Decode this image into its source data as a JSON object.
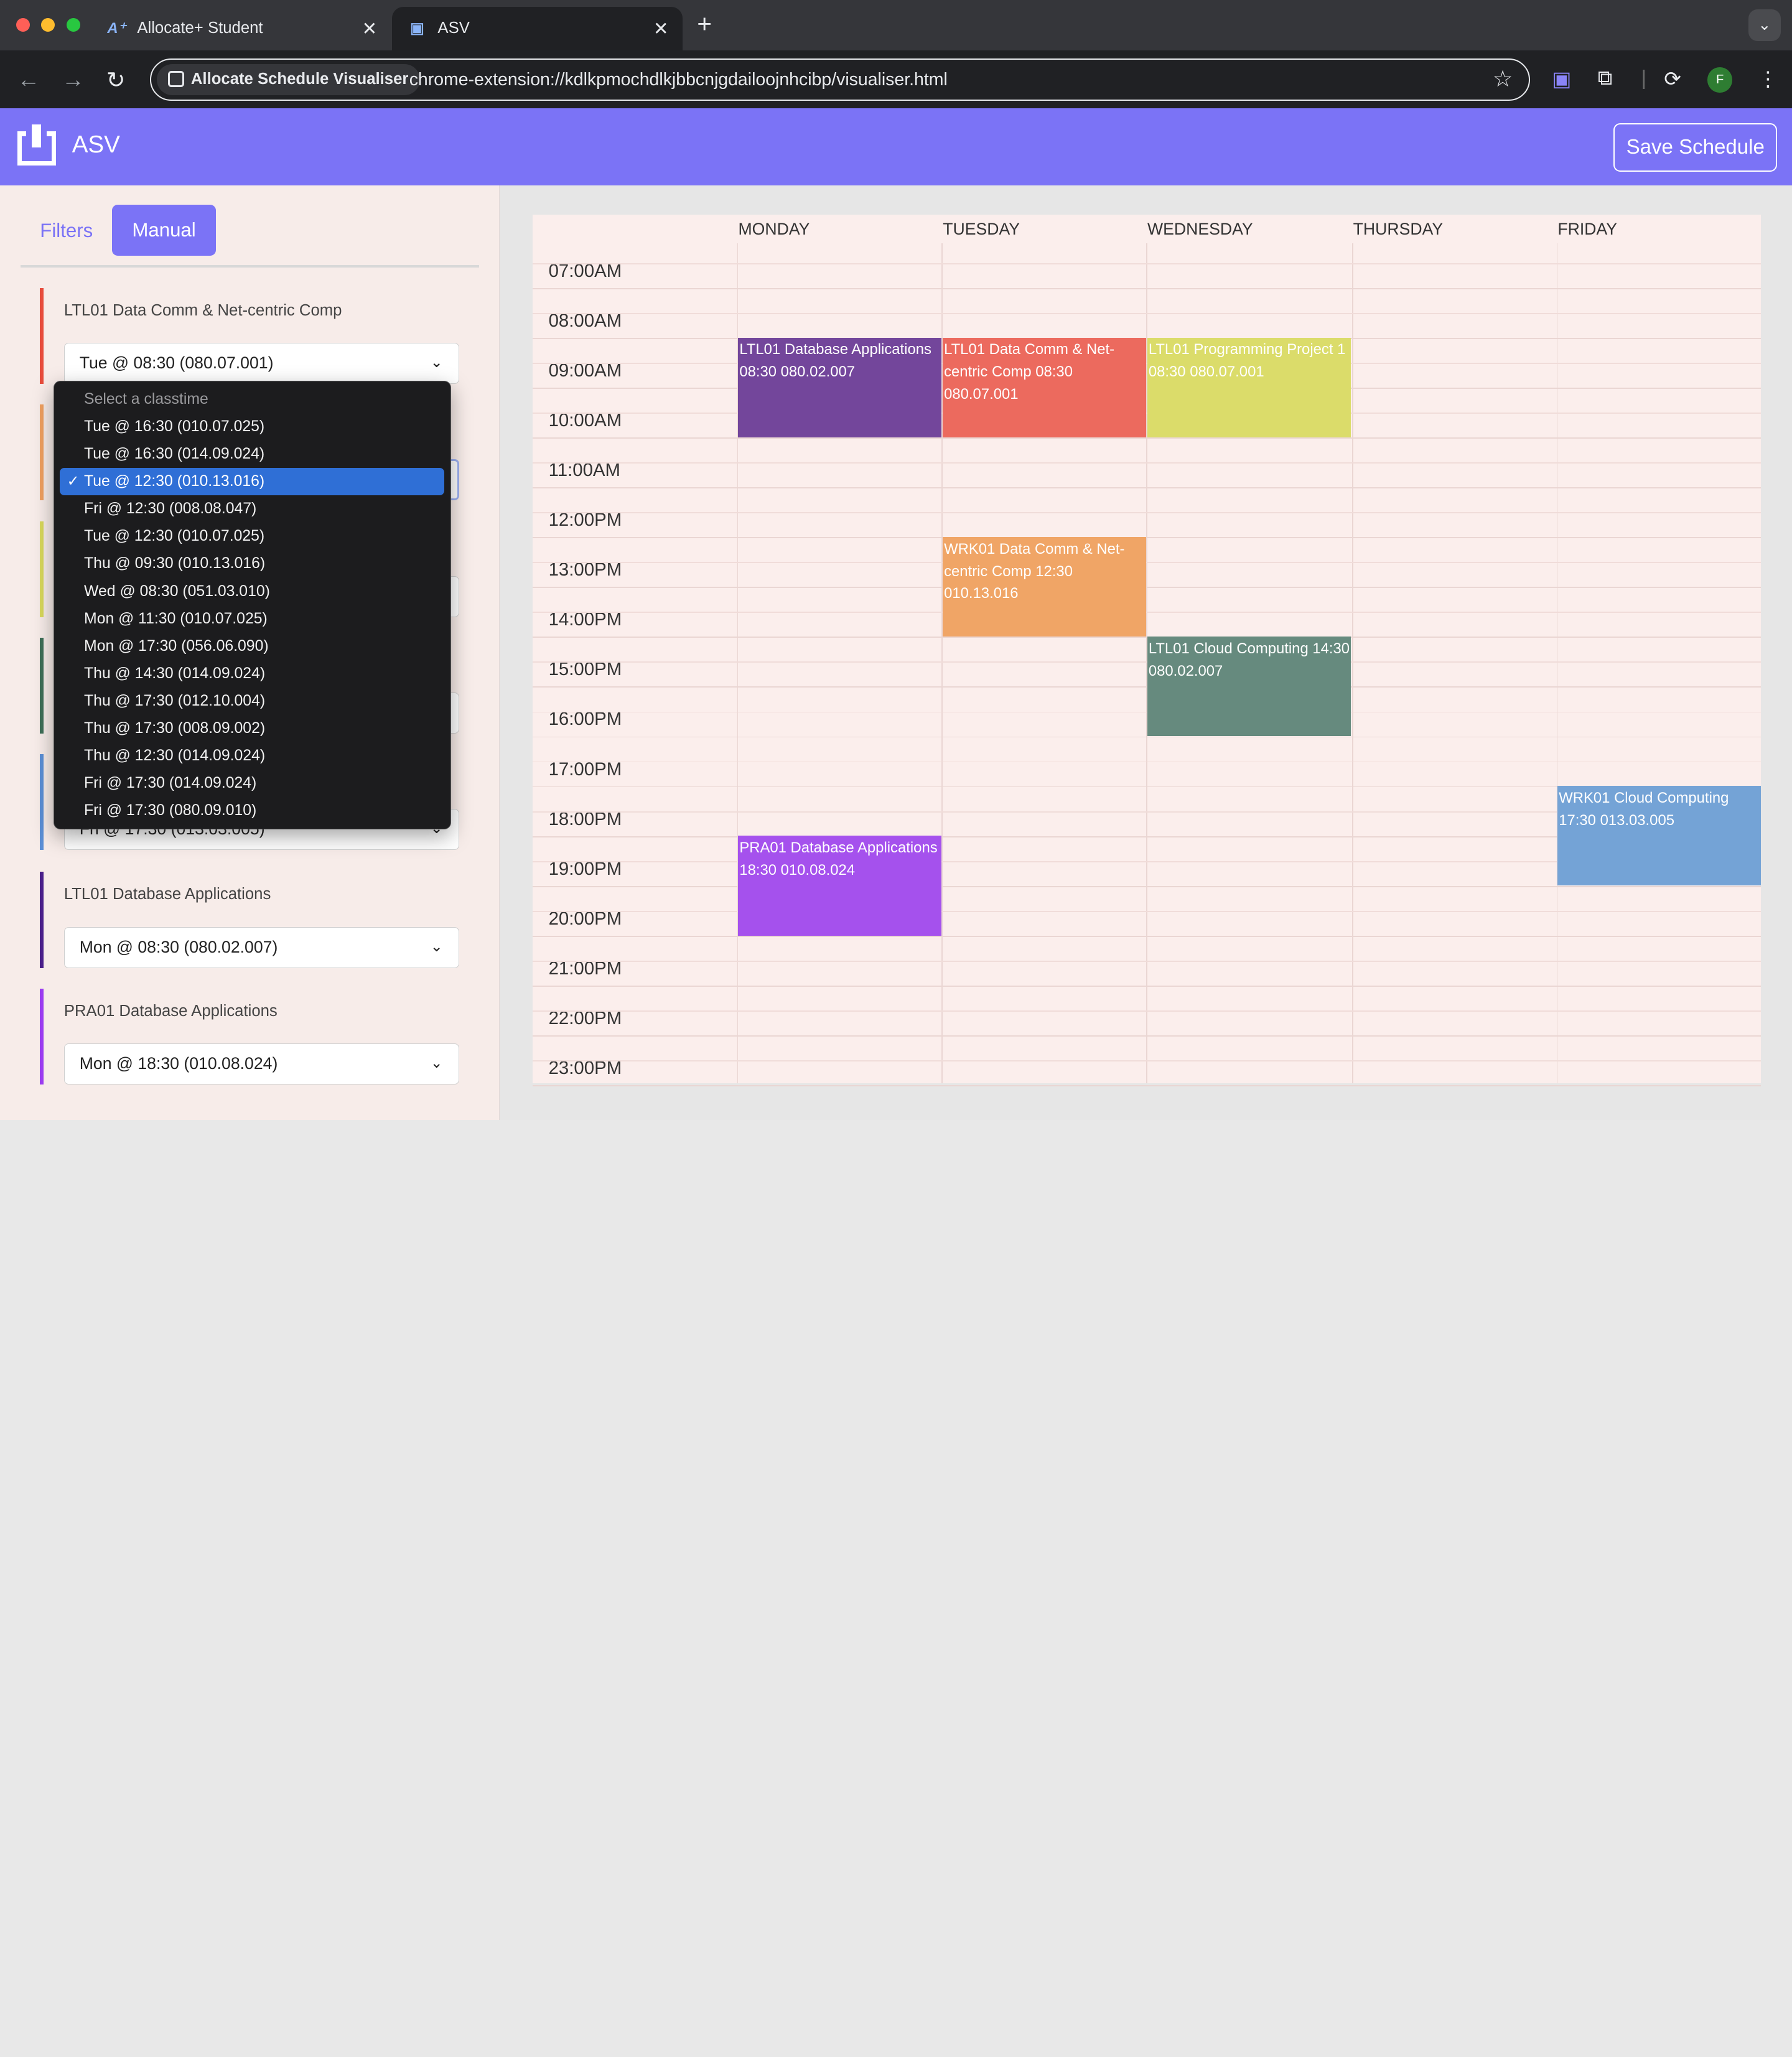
{
  "browser": {
    "tabs": [
      {
        "title": "Allocate+ Student",
        "icon": "allocate-plus-icon"
      },
      {
        "title": "ASV",
        "icon": "asv-icon"
      }
    ],
    "chip_label": "Allocate Schedule Visualiser",
    "url": "chrome-extension://kdlkpmochdlkjbbcnjgdailoojnhcibp/visualiser.html",
    "profile_initial": "F"
  },
  "app": {
    "title": "ASV",
    "save_label": "Save Schedule",
    "accent": "#7b73f6"
  },
  "panel": {
    "tabs": {
      "filters": "Filters",
      "manual": "Manual"
    },
    "courses": [
      {
        "name": "LTL01 Data Comm & Net-centric Comp",
        "selected": "Tue @ 08:30 (080.07.001)",
        "color": "#e74c3c"
      },
      {
        "name": "",
        "selected": "",
        "color": "#f0a060"
      },
      {
        "name": "",
        "selected": "",
        "color": "#d9d95c"
      },
      {
        "name": "",
        "selected": "",
        "color": "#3e6f58"
      },
      {
        "name": "",
        "selected": "Fri @ 17:30 (013.03.005)",
        "color": "#5b8fd6"
      },
      {
        "name": "LTL01 Database Applications",
        "selected": "Mon @ 08:30 (080.02.007)",
        "color": "#4a1f8a"
      },
      {
        "name": "PRA01 Database Applications",
        "selected": "Mon @ 18:30 (010.08.024)",
        "color": "#9b3cf0"
      }
    ]
  },
  "dropdown": {
    "placeholder": "Select a classtime",
    "options": [
      "Tue @ 16:30 (010.07.025)",
      "Tue @ 16:30 (014.09.024)",
      "Tue @ 12:30 (010.13.016)",
      "Fri @ 12:30 (008.08.047)",
      "Tue @ 12:30 (010.07.025)",
      "Thu @ 09:30 (010.13.016)",
      "Wed @ 08:30 (051.03.010)",
      "Mon @ 11:30 (010.07.025)",
      "Mon @ 17:30 (056.06.090)",
      "Thu @ 14:30 (014.09.024)",
      "Thu @ 17:30 (012.10.004)",
      "Thu @ 17:30 (008.09.002)",
      "Thu @ 12:30 (014.09.024)",
      "Fri @ 17:30 (014.09.024)",
      "Fri @ 17:30 (080.09.010)"
    ],
    "selected_index": 2
  },
  "calendar": {
    "days": [
      "MONDAY",
      "TUESDAY",
      "WEDNESDAY",
      "THURSDAY",
      "FRIDAY"
    ],
    "times": [
      "07:00AM",
      "08:00AM",
      "09:00AM",
      "10:00AM",
      "11:00AM",
      "12:00PM",
      "13:00PM",
      "14:00PM",
      "15:00PM",
      "16:00PM",
      "17:00PM",
      "18:00PM",
      "19:00PM",
      "20:00PM",
      "21:00PM",
      "22:00PM",
      "23:00PM"
    ],
    "events": [
      {
        "day": 0,
        "start": 8.5,
        "end": 10.5,
        "text": "LTL01 Database Applications 08:30 080.02.007",
        "color": "#73469b"
      },
      {
        "day": 1,
        "start": 8.5,
        "end": 10.5,
        "text": "LTL01 Data Comm & Net-centric Comp 08:30 080.07.001",
        "color": "#ec6a5e"
      },
      {
        "day": 2,
        "start": 8.5,
        "end": 10.5,
        "text": "LTL01 Programming Project 1 08:30 080.07.001",
        "color": "#dbdc6a"
      },
      {
        "day": 1,
        "start": 12.5,
        "end": 14.5,
        "text": "WRK01 Data Comm & Net-centric Comp 12:30 010.13.016",
        "color": "#f0a566"
      },
      {
        "day": 2,
        "start": 14.5,
        "end": 16.5,
        "text": "LTL01 Cloud Computing 14:30 080.02.007",
        "color": "#668a7e"
      },
      {
        "day": 4,
        "start": 17.5,
        "end": 19.5,
        "text": "WRK01 Cloud Computing 17:30 013.03.005",
        "color": "#74a3d6"
      },
      {
        "day": 0,
        "start": 18.5,
        "end": 20.5,
        "text": "PRA01 Database Applications 18:30 010.08.024",
        "color": "#a551ed"
      }
    ]
  }
}
